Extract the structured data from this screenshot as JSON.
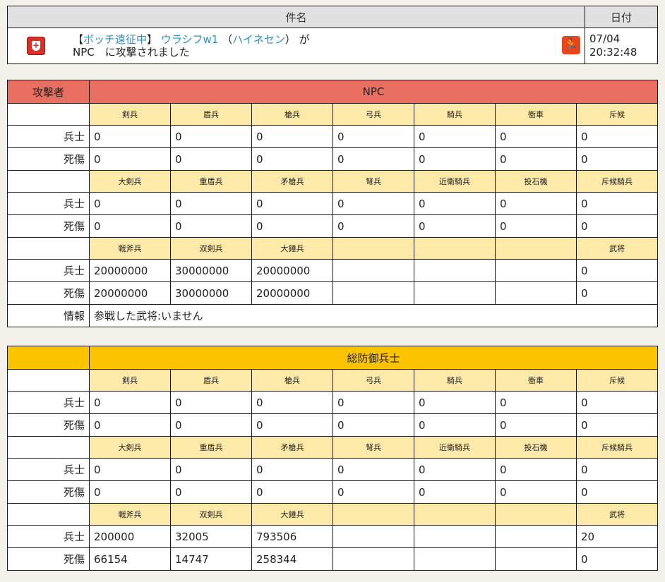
{
  "header": {
    "subject_label": "件名",
    "date_label": "日付",
    "subject_line1_prefix": "【",
    "subject_line1_link1": "ボッチ遠征中",
    "subject_line1_mid": "】",
    "subject_line1_link2": "ウラシフw1",
    "subject_line1_paren_open": "（",
    "subject_line1_link3": "ハイネセン",
    "subject_line1_paren_close": "）",
    "subject_line1_suffix": "が",
    "subject_line2": "NPC　に攻撃されました",
    "date_line1": "07/04",
    "date_line2": "20:32:48",
    "icons": [
      "shield-icon",
      "running-icon"
    ],
    "colors": {
      "link": "#2a8fc0",
      "shield": "#d9302b",
      "run": "#e8461e"
    }
  },
  "attacker": {
    "role_label": "攻撃者",
    "name": "NPC",
    "color": "#e96f61",
    "row_soldier": "兵士",
    "row_casualty": "死傷",
    "row_info": "情報",
    "info_text": "参戦した武将:いません",
    "groups": [
      {
        "units": [
          "剣兵",
          "盾兵",
          "槍兵",
          "弓兵",
          "騎兵",
          "衝車",
          "斥候"
        ],
        "soldiers": [
          "0",
          "0",
          "0",
          "0",
          "0",
          "0",
          "0"
        ],
        "casualties": [
          "0",
          "0",
          "0",
          "0",
          "0",
          "0",
          "0"
        ]
      },
      {
        "units": [
          "大剣兵",
          "重盾兵",
          "矛槍兵",
          "弩兵",
          "近衛騎兵",
          "投石機",
          "斥候騎兵"
        ],
        "soldiers": [
          "0",
          "0",
          "0",
          "0",
          "0",
          "0",
          "0"
        ],
        "casualties": [
          "0",
          "0",
          "0",
          "0",
          "0",
          "0",
          "0"
        ]
      },
      {
        "units": [
          "戦斧兵",
          "双剣兵",
          "大錘兵",
          "",
          "",
          "",
          "武将"
        ],
        "soldiers": [
          "20000000",
          "30000000",
          "20000000",
          "",
          "",
          "",
          "0"
        ],
        "casualties": [
          "20000000",
          "30000000",
          "20000000",
          "",
          "",
          "",
          "0"
        ]
      }
    ]
  },
  "defender": {
    "role_label": "",
    "name": "総防御兵士",
    "color": "#fcc400",
    "row_soldier": "兵士",
    "row_casualty": "死傷",
    "groups": [
      {
        "units": [
          "剣兵",
          "盾兵",
          "槍兵",
          "弓兵",
          "騎兵",
          "衝車",
          "斥候"
        ],
        "soldiers": [
          "0",
          "0",
          "0",
          "0",
          "0",
          "0",
          "0"
        ],
        "casualties": [
          "0",
          "0",
          "0",
          "0",
          "0",
          "0",
          "0"
        ]
      },
      {
        "units": [
          "大剣兵",
          "重盾兵",
          "矛槍兵",
          "弩兵",
          "近衛騎兵",
          "投石機",
          "斥候騎兵"
        ],
        "soldiers": [
          "0",
          "0",
          "0",
          "0",
          "0",
          "0",
          "0"
        ],
        "casualties": [
          "0",
          "0",
          "0",
          "0",
          "0",
          "0",
          "0"
        ]
      },
      {
        "units": [
          "戦斧兵",
          "双剣兵",
          "大錘兵",
          "",
          "",
          "",
          "武将"
        ],
        "soldiers": [
          "200000",
          "32005",
          "793506",
          "",
          "",
          "",
          "20"
        ],
        "casualties": [
          "66154",
          "14747",
          "258344",
          "",
          "",
          "",
          "0"
        ]
      }
    ]
  }
}
